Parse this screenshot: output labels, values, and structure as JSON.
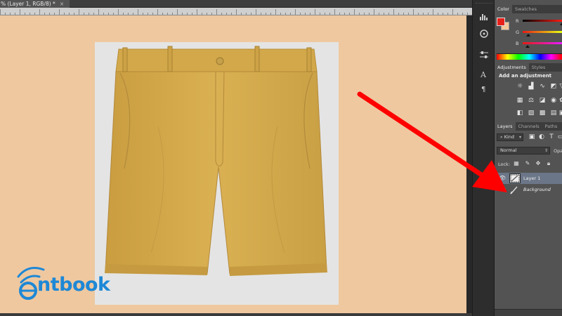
{
  "document": {
    "tab_title": "% (Layer 1, RGB/8) *",
    "tab_close": "×"
  },
  "colors": {
    "canvas_bg": "#efc8a0",
    "foreground": "#e8201a",
    "background": "#f2c79b",
    "shorts": "#d4aa4c",
    "arrow": "#ff0000",
    "logo": "#1e88d6",
    "selection": "#6b7688"
  },
  "watermark": {
    "logo_text": "ntbook"
  },
  "tools": [
    "histogram-icon",
    "libraries-icon",
    "properties-icon",
    "character-icon",
    "paragraph-icon"
  ],
  "color_panel": {
    "tabs": [
      "Color",
      "Swatches"
    ],
    "channels": [
      "R",
      "G",
      "B"
    ],
    "slider_values": [
      1.0,
      0.1,
      0.07
    ]
  },
  "adjustments_panel": {
    "tabs": [
      "Adjustments",
      "Styles"
    ],
    "title": "Add an adjustment"
  },
  "layers_panel": {
    "tabs": [
      "Layers",
      "Channels",
      "Paths"
    ],
    "filter_kind": "Kind",
    "blend_mode": "Normal",
    "opacity_label": "Opa",
    "lock_label": "Lock:",
    "layers": [
      {
        "name": "Layer 1",
        "selected": true,
        "italic": false
      },
      {
        "name": "Background",
        "selected": false,
        "italic": true
      }
    ]
  }
}
